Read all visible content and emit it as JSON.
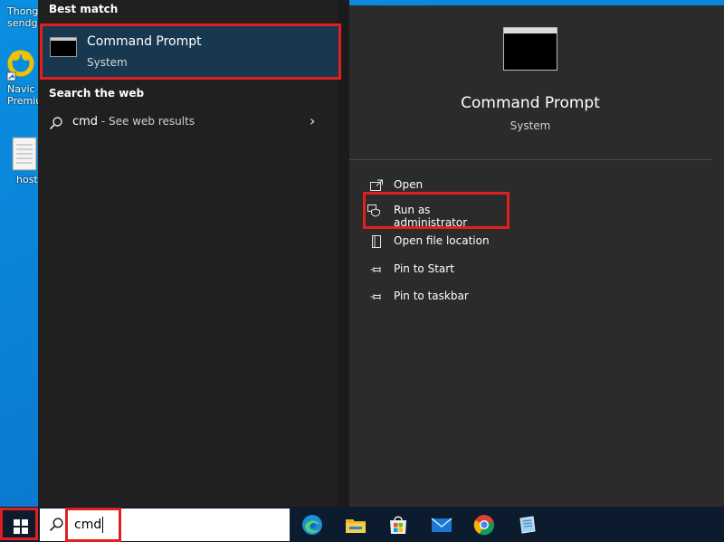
{
  "desktop": {
    "items": [
      {
        "label": "Thong",
        "label2": "sendgu"
      },
      {
        "label": "Navic",
        "label2": "Premium"
      },
      {
        "label": "host"
      }
    ]
  },
  "start_menu": {
    "best_match_header": "Best match",
    "best_match": {
      "title": "Command Prompt",
      "subtitle": "System"
    },
    "search_web_header": "Search the web",
    "web_result": {
      "query": "cmd",
      "suffix": " - See web results"
    },
    "detail": {
      "title": "Command Prompt",
      "subtitle": "System",
      "actions": [
        {
          "label": "Open",
          "icon": "open-icon"
        },
        {
          "label": "Run as administrator",
          "icon": "shield-icon"
        },
        {
          "label": "Open file location",
          "icon": "file-location-icon"
        },
        {
          "label": "Pin to Start",
          "icon": "pin-icon"
        },
        {
          "label": "Pin to taskbar",
          "icon": "pin-icon"
        }
      ]
    }
  },
  "taskbar": {
    "search_value": "cmd",
    "apps": [
      "edge-icon",
      "file-explorer-icon",
      "microsoft-store-icon",
      "mail-icon",
      "chrome-icon",
      "notepad-icon"
    ]
  },
  "colors": {
    "highlight": "#e02020",
    "selected": "#17384f",
    "taskbar": "#0c1b2d"
  }
}
